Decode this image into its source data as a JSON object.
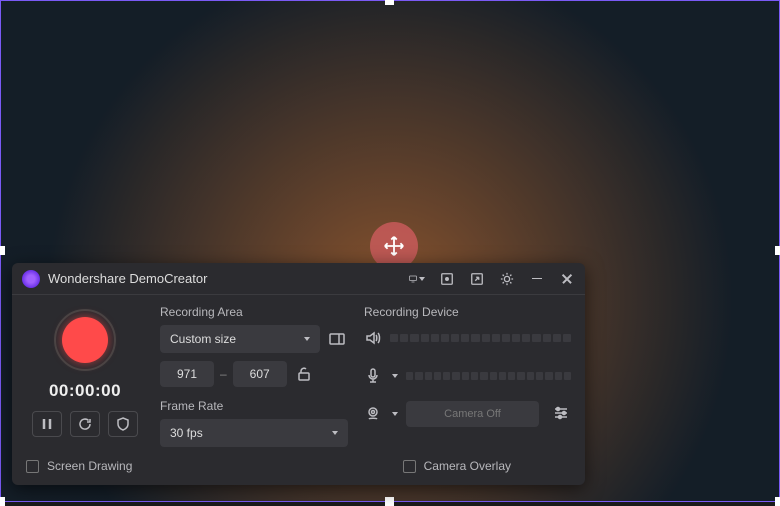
{
  "titlebar": {
    "title": "Wondershare DemoCreator"
  },
  "recorder": {
    "timer": "00:00:00"
  },
  "recording_area": {
    "label": "Recording Area",
    "size_mode": "Custom size",
    "width": "971",
    "height": "607"
  },
  "frame_rate": {
    "label": "Frame Rate",
    "value": "30 fps"
  },
  "recording_device": {
    "label": "Recording Device",
    "camera_status": "Camera Off"
  },
  "footer": {
    "screen_drawing": "Screen Drawing",
    "camera_overlay": "Camera Overlay"
  }
}
